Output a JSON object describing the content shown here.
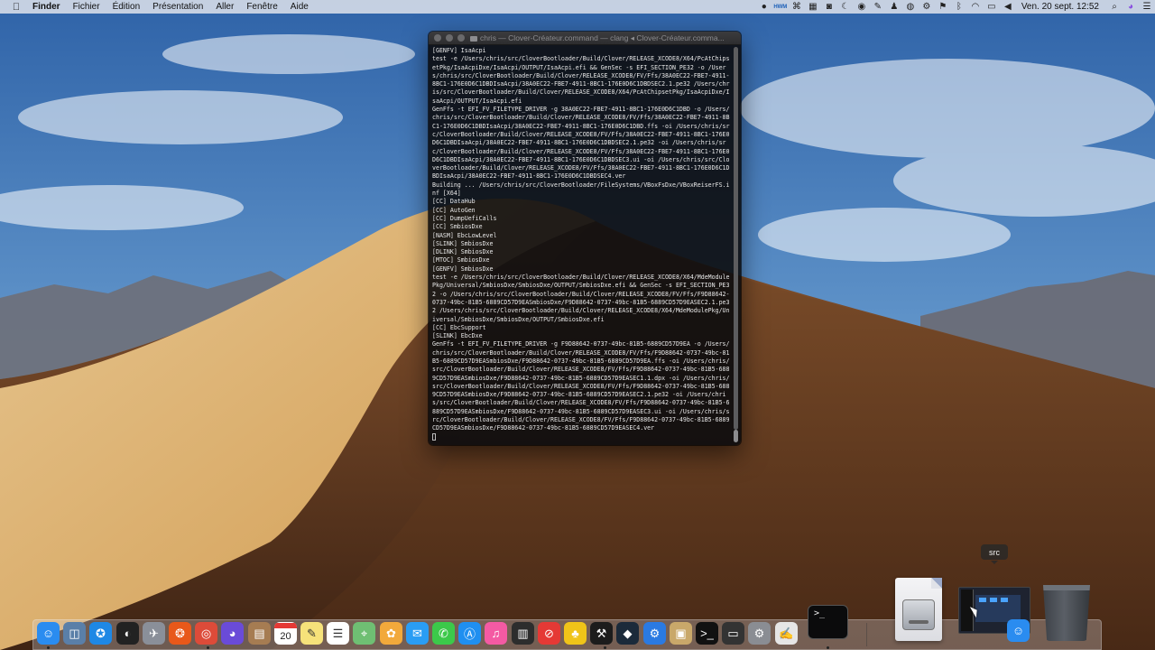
{
  "menubar": {
    "apple_icon": "apple-logo-icon",
    "items": [
      "Finder",
      "Fichier",
      "Édition",
      "Présentation",
      "Aller",
      "Fenêtre",
      "Aide"
    ],
    "status_icons": [
      "record-icon",
      "hwmonitor-icon",
      "command-icon",
      "grid-icon",
      "camera-icon",
      "moon-icon",
      "eye-icon",
      "color-picker-icon",
      "android-icon",
      "disk-icon",
      "gear-icon",
      "flag-icon",
      "bluetooth-icon",
      "wifi-icon",
      "battery-icon",
      "volume-icon"
    ],
    "hwmonitor_label": "HWM",
    "clock": "Ven. 20 sept.  12:52",
    "search_icon": "search-icon",
    "siri_icon": "siri-icon",
    "notifications_icon": "notification-center-icon"
  },
  "terminal": {
    "title": "chris — Clover-Créateur.command — clang ◂ Clover-Créateur.comma...",
    "lines": [
      "[GENFV] IsaAcpi",
      "test -e /Users/chris/src/CloverBootloader/Build/Clover/RELEASE_XCODE8/X64/PcAtChipsetPkg/IsaAcpiDxe/IsaAcpi/OUTPUT/IsaAcpi.efi && GenSec -s EFI_SECTION_PE32 -o /Users/chris/src/CloverBootloader/Build/Clover/RELEASE_XCODE8/FV/Ffs/38A0EC22-FBE7-4911-8BC1-176E0D6C1DBDIsaAcpi/38A0EC22-FBE7-4911-8BC1-176E0D6C1DBDSEC2.1.pe32 /Users/chris/src/CloverBootloader/Build/Clover/RELEASE_XCODE8/X64/PcAtChipsetPkg/IsaAcpiDxe/IsaAcpi/OUTPUT/IsaAcpi.efi",
      "GenFfs -t EFI_FV_FILETYPE_DRIVER -g 38A0EC22-FBE7-4911-8BC1-176E0D6C1DBD -o /Users/chris/src/CloverBootloader/Build/Clover/RELEASE_XCODE8/FV/Ffs/38A0EC22-FBE7-4911-8BC1-176E0D6C1DBDIsaAcpi/38A0EC22-FBE7-4911-8BC1-176E0D6C1DBD.ffs -oi /Users/chris/src/CloverBootloader/Build/Clover/RELEASE_XCODE8/FV/Ffs/38A0EC22-FBE7-4911-8BC1-176E0D6C1DBDIsaAcpi/38A0EC22-FBE7-4911-8BC1-176E0D6C1DBDSEC2.1.pe32 -oi /Users/chris/src/CloverBootloader/Build/Clover/RELEASE_XCODE8/FV/Ffs/38A0EC22-FBE7-4911-8BC1-176E0D6C1DBDIsaAcpi/38A0EC22-FBE7-4911-8BC1-176E0D6C1DBDSEC3.ui -oi /Users/chris/src/CloverBootloader/Build/Clover/RELEASE_XCODE8/FV/Ffs/38A0EC22-FBE7-4911-8BC1-176E0D6C1DBDIsaAcpi/38A0EC22-FBE7-4911-8BC1-176E0D6C1DBDSEC4.ver",
      "Building ... /Users/chris/src/CloverBootloader/FileSystems/VBoxFsDxe/VBoxReiserFS.inf [X64]",
      "[CC] DataHub",
      "[CC] AutoGen",
      "[CC] DumpUefiCalls",
      "[CC] SmbiosDxe",
      "[NASM] EbcLowLevel",
      "[SLINK] SmbiosDxe",
      "[DLINK] SmbiosDxe",
      "[MTOC] SmbiosDxe",
      "[GENFV] SmbiosDxe",
      "test -e /Users/chris/src/CloverBootloader/Build/Clover/RELEASE_XCODE8/X64/MdeModulePkg/Universal/SmbiosDxe/SmbiosDxe/OUTPUT/SmbiosDxe.efi && GenSec -s EFI_SECTION_PE32 -o /Users/chris/src/CloverBootloader/Build/Clover/RELEASE_XCODE8/FV/Ffs/F9D88642-0737-49bc-81B5-6889CD57D9EASmbiosDxe/F9D88642-0737-49bc-81B5-6889CD57D9EASEC2.1.pe32 /Users/chris/src/CloverBootloader/Build/Clover/RELEASE_XCODE8/X64/MdeModulePkg/Universal/SmbiosDxe/SmbiosDxe/OUTPUT/SmbiosDxe.efi",
      "[CC] EbcSupport",
      "[SLINK] EbcDxe",
      "GenFfs -t EFI_FV_FILETYPE_DRIVER -g F9D88642-0737-49bc-81B5-6889CD57D9EA -o /Users/chris/src/CloverBootloader/Build/Clover/RELEASE_XCODE8/FV/Ffs/F9D88642-0737-49bc-81B5-6889CD57D9EASmbiosDxe/F9D88642-0737-49bc-81B5-6889CD57D9EA.ffs -oi /Users/chris/src/CloverBootloader/Build/Clover/RELEASE_XCODE8/FV/Ffs/F9D88642-0737-49bc-81B5-6889CD57D9EASmbiosDxe/F9D88642-0737-49bc-81B5-6889CD57D9EASEC1.1.dpx -oi /Users/chris/src/CloverBootloader/Build/Clover/RELEASE_XCODE8/FV/Ffs/F9D88642-0737-49bc-81B5-6889CD57D9EASmbiosDxe/F9D88642-0737-49bc-81B5-6889CD57D9EASEC2.1.pe32 -oi /Users/chris/src/CloverBootloader/Build/Clover/RELEASE_XCODE8/FV/Ffs/F9D88642-0737-49bc-81B5-6889CD57D9EASmbiosDxe/F9D88642-0737-49bc-81B5-6889CD57D9EASEC3.ui -oi /Users/chris/src/CloverBootloader/Build/Clover/RELEASE_XCODE8/FV/Ffs/F9D88642-0737-49bc-81B5-6889CD57D9EASmbiosDxe/F9D88642-0737-49bc-81B5-6889CD57D9EASEC4.ver"
    ]
  },
  "dock": {
    "apps": [
      {
        "name": "finder-icon",
        "color": "#2a8cf0"
      },
      {
        "name": "preview-icon",
        "color": "#5a7fa8"
      },
      {
        "name": "safari-icon",
        "color": "#1e88e5"
      },
      {
        "name": "siri-dashboard-icon",
        "color": "#222222"
      },
      {
        "name": "launchpad-icon",
        "color": "#8a8f99"
      },
      {
        "name": "firefox-icon",
        "color": "#e8581a"
      },
      {
        "name": "chrome-icon",
        "color": "#dd4b39"
      },
      {
        "name": "siri-icon",
        "color": "#6a4bd8"
      },
      {
        "name": "contacts-icon",
        "color": "#a67c52"
      },
      {
        "name": "calendar-icon",
        "color": "#ffffff"
      },
      {
        "name": "notes-icon",
        "color": "#f6e27a"
      },
      {
        "name": "reminders-icon",
        "color": "#ffffff"
      },
      {
        "name": "maps-icon",
        "color": "#6fbf73"
      },
      {
        "name": "photos-icon",
        "color": "#f2a93b"
      },
      {
        "name": "messages-icon",
        "color": "#2a9df4"
      },
      {
        "name": "facetime-icon",
        "color": "#3cc94a"
      },
      {
        "name": "app-store-icon",
        "color": "#1f8ff0"
      },
      {
        "name": "itunes-icon",
        "color": "#f45aa3"
      },
      {
        "name": "mission-control-icon",
        "color": "#2d2d2d"
      },
      {
        "name": "no-entry-icon",
        "color": "#e53935"
      },
      {
        "name": "clover-configurator-icon",
        "color": "#f0c419"
      },
      {
        "name": "xcode-icon",
        "color": "#1c1c1c"
      },
      {
        "name": "dropbox-icon",
        "color": "#1b2a3a"
      },
      {
        "name": "xcode-tools-icon",
        "color": "#2a7ae2"
      },
      {
        "name": "archive-icon",
        "color": "#c9a86a"
      },
      {
        "name": "terminal-small-icon",
        "color": "#111111"
      },
      {
        "name": "remote-desktop-icon",
        "color": "#333333"
      },
      {
        "name": "system-preferences-icon",
        "color": "#8a8d93"
      },
      {
        "name": "script-editor-icon",
        "color": "#e6e6e6"
      }
    ],
    "calendar_day": "20",
    "terminal_prompt": ">_",
    "folder_label": "src"
  }
}
